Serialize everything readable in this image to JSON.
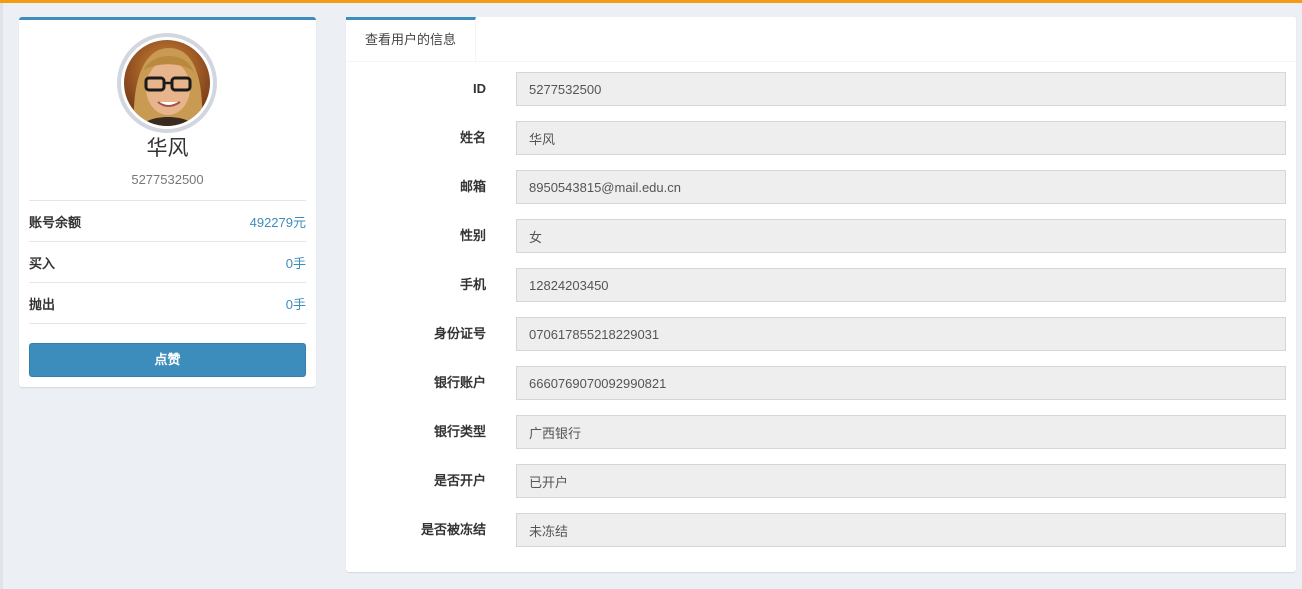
{
  "profile": {
    "name": "华风",
    "id": "5277532500",
    "stats": [
      {
        "label": "账号余额",
        "value": "492279元"
      },
      {
        "label": "买入",
        "value": "0手"
      },
      {
        "label": "抛出",
        "value": "0手"
      }
    ],
    "like_button": "点赞"
  },
  "info": {
    "tab_label": "查看用户的信息",
    "fields": [
      {
        "label": "ID",
        "value": "5277532500"
      },
      {
        "label": "姓名",
        "value": "华风"
      },
      {
        "label": "邮箱",
        "value": "8950543815@mail.edu.cn"
      },
      {
        "label": "性别",
        "value": "女"
      },
      {
        "label": "手机",
        "value": "12824203450"
      },
      {
        "label": "身份证号",
        "value": "070617855218229031"
      },
      {
        "label": "银行账户",
        "value": "6660769070092990821"
      },
      {
        "label": "银行类型",
        "value": "广西银行"
      },
      {
        "label": "是否开户",
        "value": "已开户"
      },
      {
        "label": "是否被冻结",
        "value": "未冻结"
      }
    ]
  },
  "colors": {
    "accent": "#3c8dbc",
    "top_bar": "#f39c12",
    "background": "#ecf0f5"
  }
}
